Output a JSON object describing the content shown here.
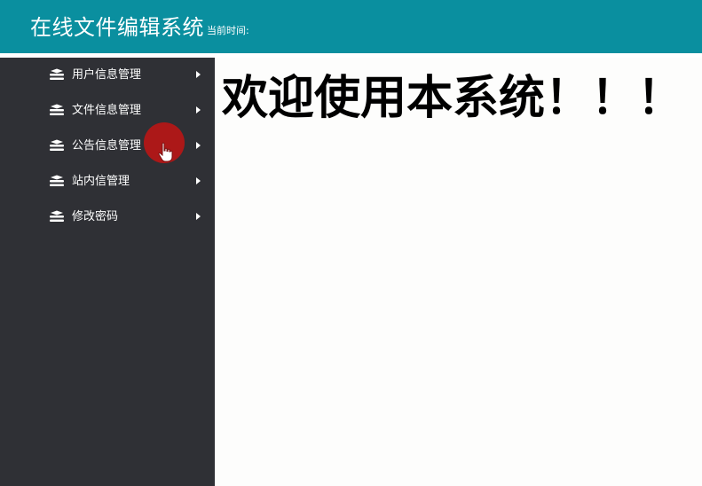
{
  "header": {
    "title": "在线文件编辑系统",
    "time_label": "当前时间:"
  },
  "sidebar": {
    "items": [
      {
        "label": "用户信息管理",
        "icon": "layers-icon"
      },
      {
        "label": "文件信息管理",
        "icon": "layers-icon"
      },
      {
        "label": "公告信息管理",
        "icon": "layers-icon"
      },
      {
        "label": "站内信管理",
        "icon": "layers-icon"
      },
      {
        "label": "修改密码",
        "icon": "layers-icon"
      }
    ]
  },
  "main": {
    "welcome": "欢迎使用本系统！！！"
  },
  "colors": {
    "header_bg": "#0a8f9f",
    "sidebar_bg": "#2f3035",
    "main_bg": "#fdfdfc",
    "cursor_highlight": "#be1414"
  }
}
